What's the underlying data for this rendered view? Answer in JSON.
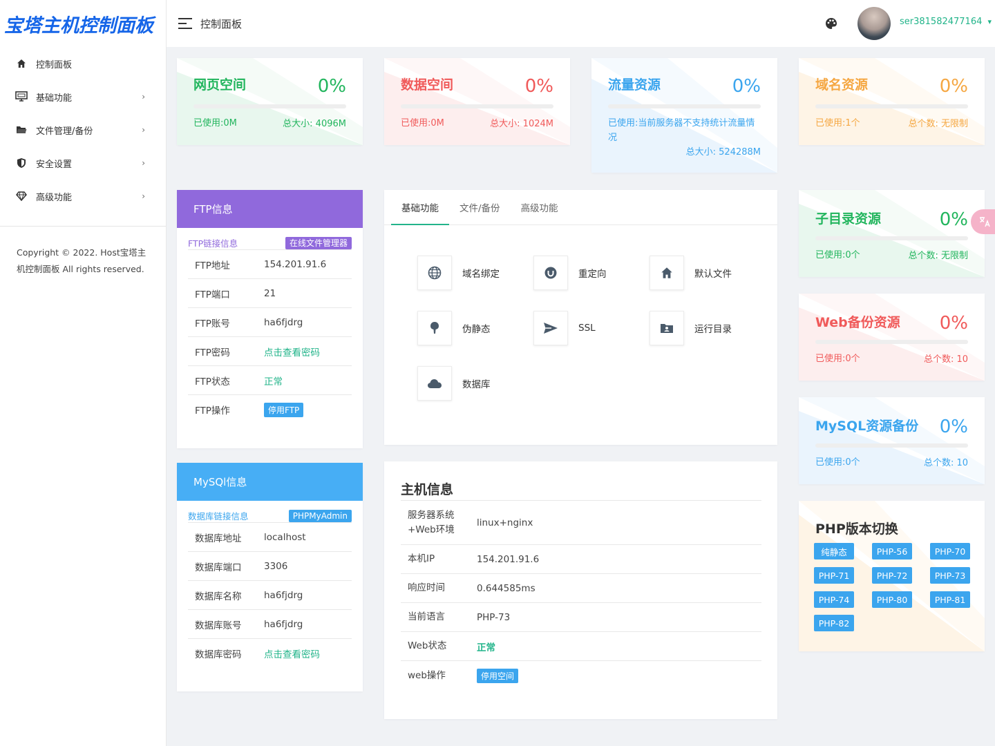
{
  "app": {
    "logo": "宝塔主机控制面板",
    "header_title": "控制面板",
    "username": "ser381582477164",
    "caret": "▾"
  },
  "sidebar": {
    "items": [
      {
        "label": "控制面板",
        "icon": "home-icon",
        "has_children": false
      },
      {
        "label": "基础功能",
        "icon": "monitor-icon",
        "has_children": true
      },
      {
        "label": "文件管理/备份",
        "icon": "folder-icon",
        "has_children": true
      },
      {
        "label": "安全设置",
        "icon": "shield-icon",
        "has_children": true
      },
      {
        "label": "高级功能",
        "icon": "diamond-icon",
        "has_children": true
      }
    ],
    "chevron": "›",
    "copyright": "Copyright © 2022. Host宝塔主机控制面板 All rights reserved."
  },
  "stats": {
    "web_space": {
      "title": "网页空间",
      "percent": "0%",
      "progress": 0,
      "used": "已使用:0M",
      "total": "总大小: 4096M"
    },
    "db_space": {
      "title": "数据空间",
      "percent": "0%",
      "progress": 0,
      "used": "已使用:0M",
      "total": "总大小: 1024M"
    },
    "traffic": {
      "title": "流量资源",
      "percent": "0%",
      "progress": 0,
      "used": "已使用:当前服务器不支持统计流量情况",
      "total": "总大小: 524288M"
    },
    "domain": {
      "title": "域名资源",
      "percent": "0%",
      "progress": 0,
      "used": "已使用:1个",
      "total": "总个数: 无限制"
    },
    "subdir": {
      "title": "子目录资源",
      "percent": "0%",
      "progress": 0,
      "used": "已使用:0个",
      "total": "总个数: 无限制"
    },
    "web_backup": {
      "title": "Web备份资源",
      "percent": "0%",
      "progress": 0,
      "used": "已使用:0个",
      "total": "总个数: 10"
    },
    "mysql_backup": {
      "title": "MySQL资源备份",
      "percent": "0%",
      "progress": 0,
      "used": "已使用:0个",
      "total": "总个数: 10"
    }
  },
  "ftp": {
    "title": "FTP信息",
    "sub_label": "FTP链接信息",
    "badge": "在线文件管理器",
    "rows": [
      {
        "k": "FTP地址",
        "v": "154.201.91.6"
      },
      {
        "k": "FTP端口",
        "v": "21"
      },
      {
        "k": "FTP账号",
        "v": "ha6fjdrg"
      },
      {
        "k": "FTP密码",
        "v": "点击查看密码"
      },
      {
        "k": "FTP状态",
        "v": "正常"
      },
      {
        "k": "FTP操作",
        "v": "停用FTP"
      }
    ]
  },
  "mysql": {
    "title": "MySQl信息",
    "sub_label": "数据库链接信息",
    "badge": "PHPMyAdmin",
    "rows": [
      {
        "k": "数据库地址",
        "v": "localhost"
      },
      {
        "k": "数据库端口",
        "v": "3306"
      },
      {
        "k": "数据库名称",
        "v": "ha6fjdrg"
      },
      {
        "k": "数据库账号",
        "v": "ha6fjdrg"
      },
      {
        "k": "数据库密码",
        "v": "点击查看密码"
      }
    ]
  },
  "functions": {
    "tabs": [
      "基础功能",
      "文件/备份",
      "高级功能"
    ],
    "items": [
      {
        "label": "域名绑定",
        "icon": "globe-icon"
      },
      {
        "label": "重定向",
        "icon": "redirect-icon"
      },
      {
        "label": "默认文件",
        "icon": "home-icon"
      },
      {
        "label": "伪静态",
        "icon": "pin-icon"
      },
      {
        "label": "SSL",
        "icon": "send-icon"
      },
      {
        "label": "运行目录",
        "icon": "folder-user-icon"
      },
      {
        "label": "数据库",
        "icon": "cloud-icon"
      }
    ]
  },
  "host": {
    "title": "主机信息",
    "rows": [
      {
        "k": "服务器系统+Web环境",
        "v": "linux+nginx"
      },
      {
        "k": "本机IP",
        "v": "154.201.91.6"
      },
      {
        "k": "响应时间",
        "v": "0.644585ms"
      },
      {
        "k": "当前语言",
        "v": "PHP-73"
      },
      {
        "k": "Web状态",
        "v": "正常"
      },
      {
        "k": "web操作",
        "v": "停用空间"
      }
    ]
  },
  "php": {
    "title": "PHP版本切换",
    "versions": [
      "纯静态",
      "PHP-56",
      "PHP-70",
      "PHP-71",
      "PHP-72",
      "PHP-73",
      "PHP-74",
      "PHP-80",
      "PHP-81",
      "PHP-82"
    ]
  },
  "colors": {
    "green": "#22b55d",
    "red": "#f05a5a",
    "blue": "#3ba5ee",
    "orange": "#f5a742",
    "purple": "#9069dc",
    "teal": "#22b48a",
    "logo": "#1565e8"
  }
}
